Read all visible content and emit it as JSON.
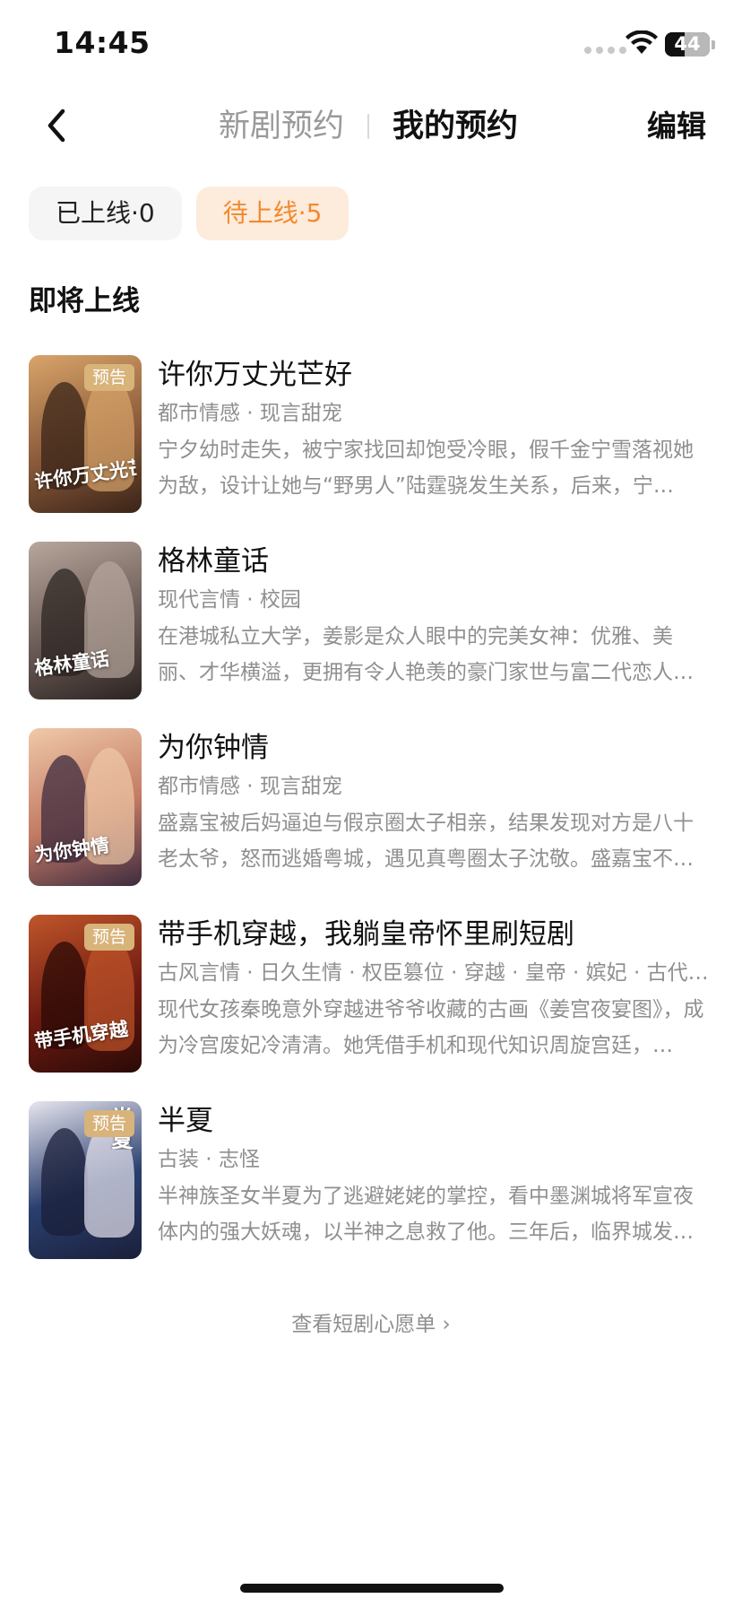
{
  "status_bar": {
    "time": "14:45",
    "battery": "44",
    "battery_level": 0.44
  },
  "nav": {
    "tabs": [
      {
        "label": "新剧预约",
        "active": false
      },
      {
        "label": "我的预约",
        "active": true
      }
    ],
    "edit_label": "编辑"
  },
  "filters": [
    {
      "label": "已上线·0",
      "selected": false
    },
    {
      "label": "待上线·5",
      "selected": true
    }
  ],
  "section": {
    "title": "即将上线"
  },
  "dramas": [
    {
      "title": "许你万丈光芒好",
      "tags": "都市情感 · 现言甜宠",
      "description": "宁夕幼时走失，被宁家找回却饱受冷眼，假千金宁雪落视她为敌，设计让她与“野男人”陆霆骁发生关系，后来，宁…",
      "badge": "预告",
      "poster_text": "许你万丈光芒好",
      "poster_colors": [
        "#8a5a3a",
        "#d9a46a",
        "#3a2418"
      ]
    },
    {
      "title": "格林童话",
      "tags": "现代言情 · 校园",
      "description": "在港城私立大学，姜影是众人眼中的完美女神：优雅、美丽、才华横溢，更拥有令人艳羡的豪门家世与富二代恋人…",
      "badge": "",
      "poster_text": "格林童话",
      "poster_colors": [
        "#6a5a55",
        "#b7a79c",
        "#2c2422"
      ]
    },
    {
      "title": "为你钟情",
      "tags": "都市情感 · 现言甜宠",
      "description": "盛嘉宝被后妈逼迫与假京圈太子相亲，结果发现对方是八十老太爷，怒而逃婚粤城，遇见真粤圈太子沈敬。盛嘉宝不…",
      "badge": "",
      "poster_text": "为你钟情",
      "poster_colors": [
        "#c27a64",
        "#f0c9a8",
        "#3d2b3f"
      ]
    },
    {
      "title": "带手机穿越，我躺皇帝怀里刷短剧",
      "tags": "古风言情 · 日久生情 · 权臣篡位 · 穿越 · 皇帝 · 嫔妃 · 古代…",
      "description": "现代女孩秦晚意外穿越进爷爷收藏的古画《姜宫夜宴图》，成为冷宫废妃冷清清。她凭借手机和现代知识周旋宫廷，…",
      "badge": "预告",
      "poster_text": "带手机穿越",
      "poster_colors": [
        "#6e1a12",
        "#c0562a",
        "#2a0a06"
      ]
    },
    {
      "title": "半夏",
      "tags": "古装 · 志怪",
      "description": "半神族圣女半夏为了逃避姥姥的掌控，看中墨渊城将军宣夜体内的强大妖魂，以半神之息救了他。三年后，临界城发…",
      "badge": "预告",
      "poster_text": "半夏",
      "poster_colors": [
        "#2a3f6e",
        "#e8e6ef",
        "#1a1f3a"
      ]
    }
  ],
  "wishlist_link": "查看短剧心愿单 ›",
  "colors": {
    "accent": "#f28a2e",
    "chip_selected_bg": "#fdebdc",
    "badge": "#d8b37a",
    "muted_text": "#8f8f8f"
  },
  "icons": {
    "back": "chevron-left-icon",
    "wifi": "wifi-icon",
    "signal": "signal-icon",
    "battery": "battery-icon"
  }
}
